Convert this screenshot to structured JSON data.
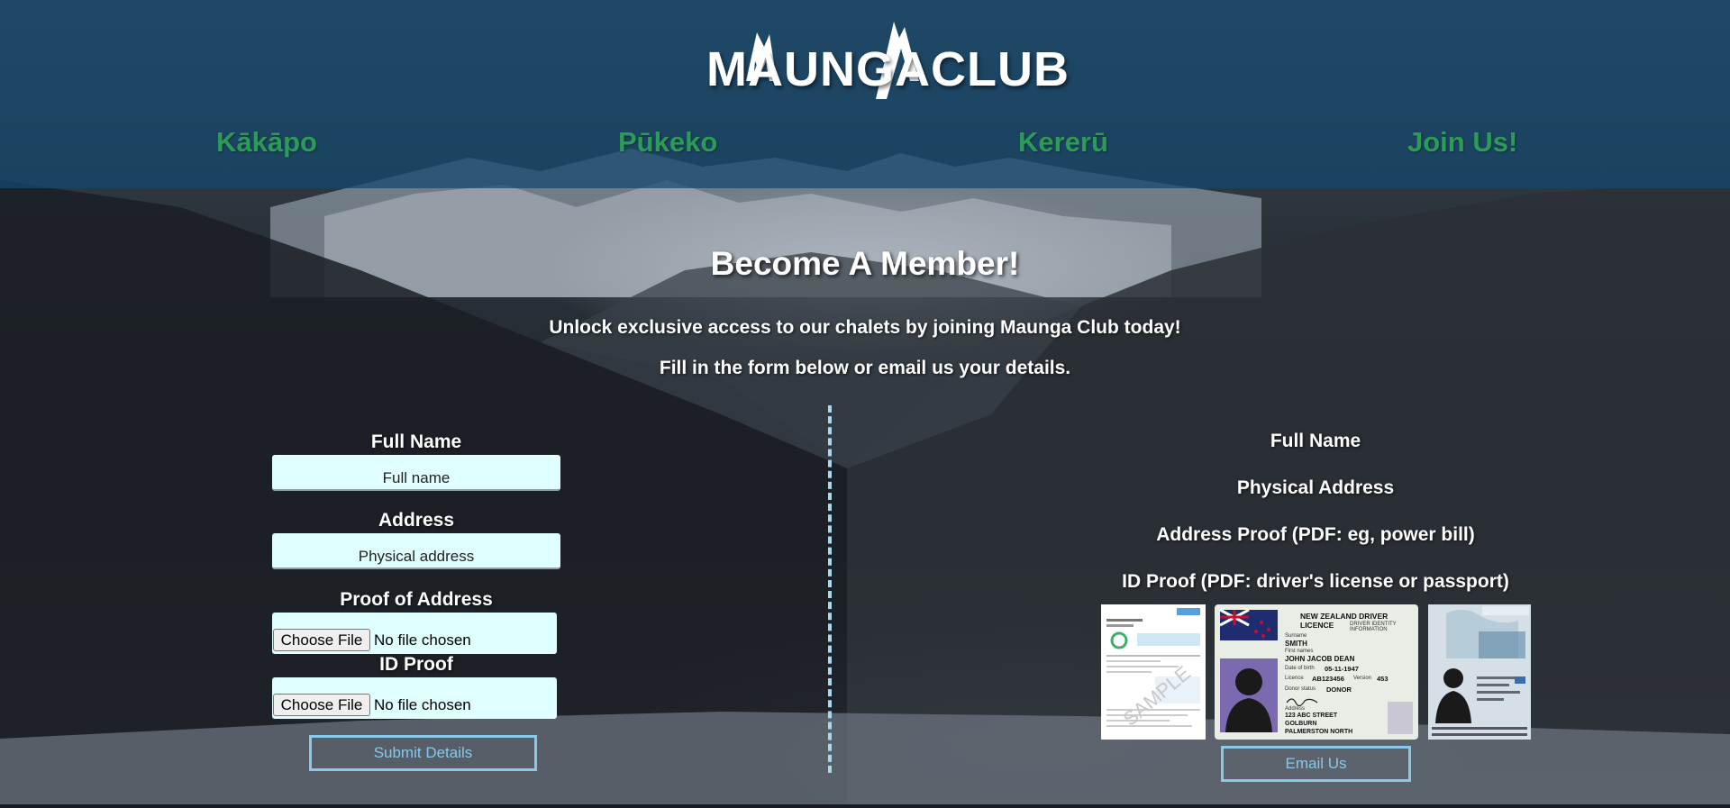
{
  "header": {
    "logo_text": "MAUNGACLUB",
    "nav": [
      "Kākāpo",
      "Pūkeko",
      "Kererū",
      "Join Us!"
    ],
    "nav_color": "#2e9a57",
    "background": "#14486e"
  },
  "main": {
    "title": "Become A Member!",
    "intro_line1": "Unlock exclusive access to our chalets by joining Maunga Club today!",
    "intro_line2": "Fill in the form below or email us your details."
  },
  "form": {
    "full_name_label": "Full Name",
    "full_name_placeholder": "Full name",
    "address_label": "Address",
    "address_placeholder": "Physical address",
    "proof_label": "Proof of Address",
    "id_label": "ID Proof",
    "choose_file": "Choose File",
    "no_file": "No file chosen",
    "submit": "Submit Details"
  },
  "email_panel": {
    "items": [
      "Full Name",
      "Physical Address",
      "Address Proof (PDF: eg, power bill)",
      "ID Proof (PDF: driver's license or passport)"
    ],
    "bill_sample_watermark": "SAMPLE",
    "licence": {
      "title": "NEW ZEALAND DRIVER LICENCE",
      "subtitle": "DRIVER IDENTITY INFORMATION",
      "surname_label": "Surname",
      "surname": "SMITH",
      "first_names_label": "First names",
      "first_names": "JOHN JACOB DEAN",
      "dob_label": "Date of birth",
      "dob": "05-11-1947",
      "licence_label": "Licence",
      "licence_no": "AB123456",
      "version_label": "Version",
      "version": "453",
      "donor_label": "Donor status",
      "donor": "DONOR",
      "address_label": "Address",
      "address_lines": [
        "123 ABC STREET",
        "GOLBURN",
        "PALMERSTON NORTH"
      ]
    },
    "email_button": "Email Us"
  }
}
